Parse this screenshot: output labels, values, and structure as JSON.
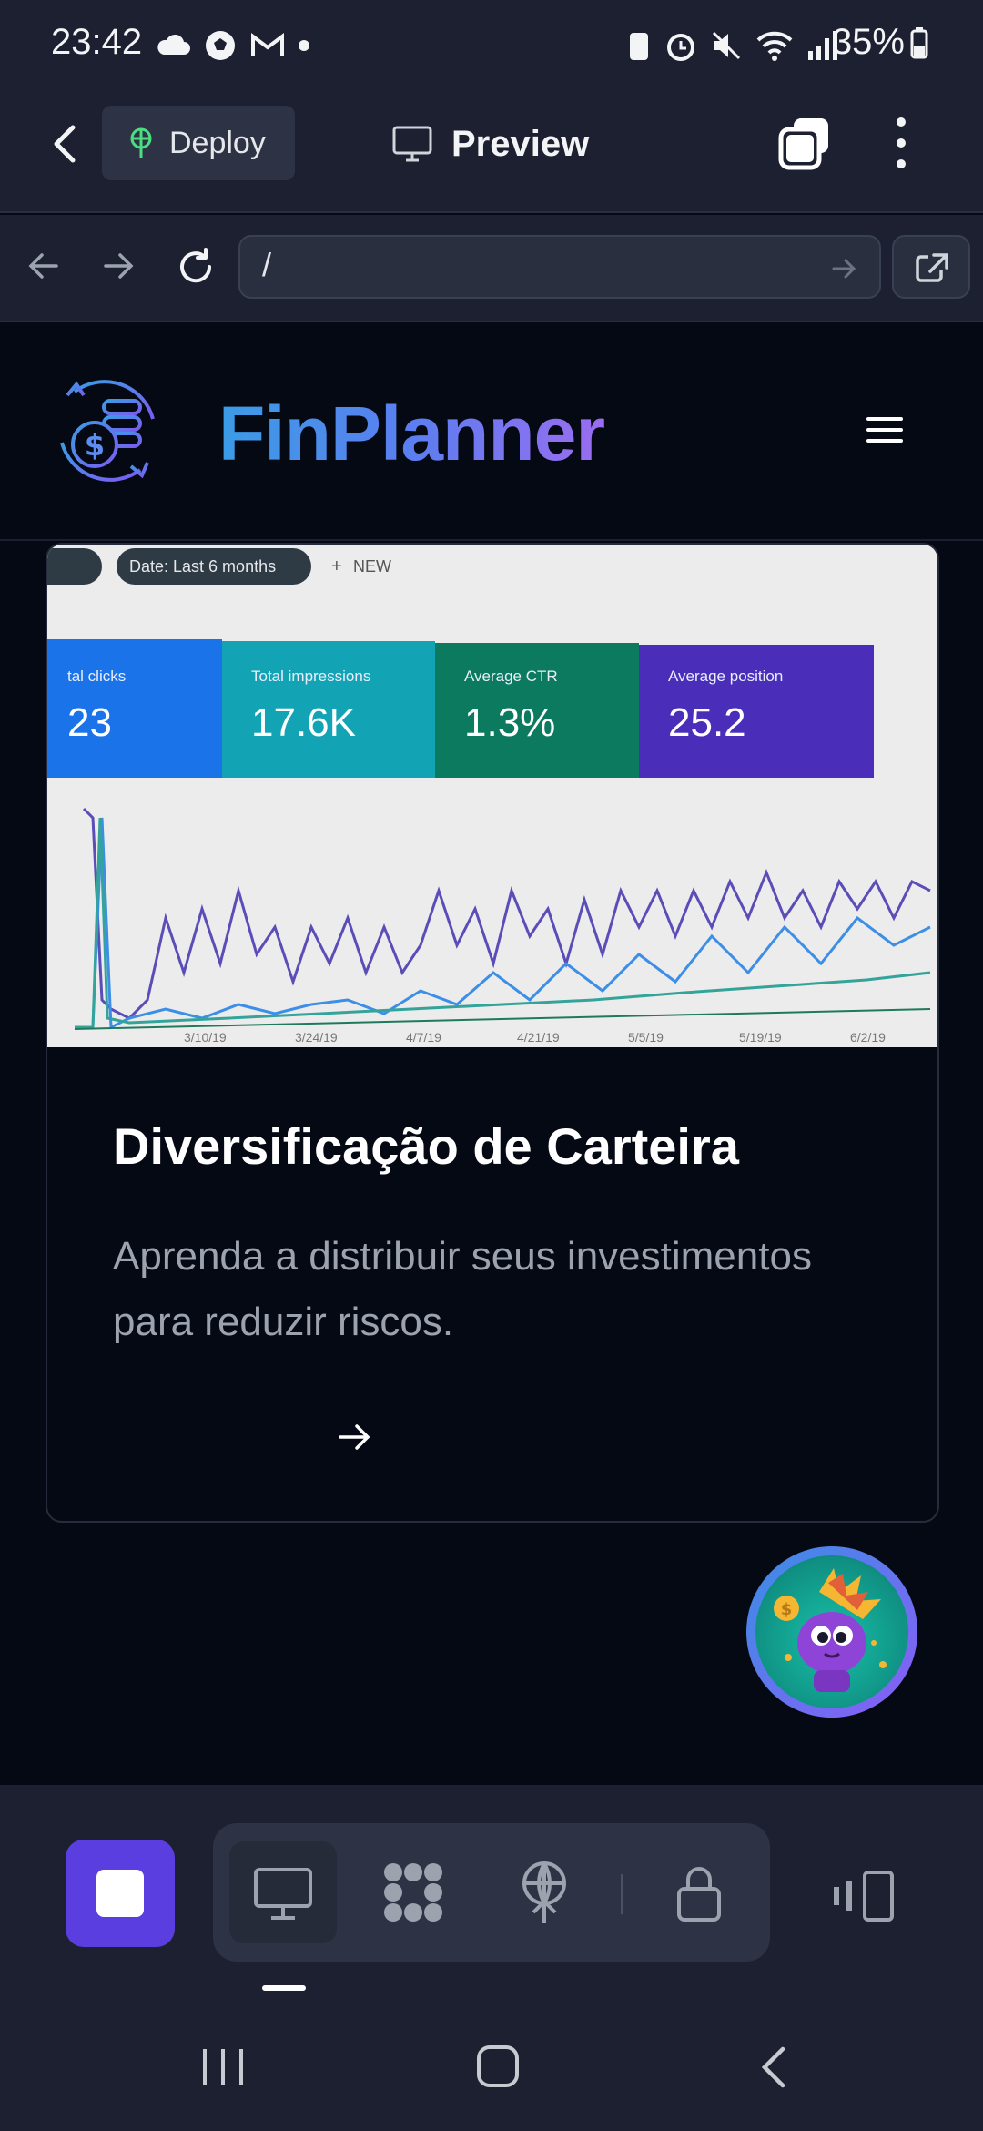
{
  "status_bar": {
    "time": "23:42",
    "battery": "35%"
  },
  "app_bar": {
    "back_icon": "chevron-left-icon",
    "deploy_label": "Deploy",
    "preview_label": "Preview"
  },
  "browser": {
    "url": "/"
  },
  "site": {
    "brand": "FinPlanner"
  },
  "card": {
    "image_alt": "Search console performance chart",
    "image_chips": [
      "Date: Last 6 months",
      "NEW"
    ],
    "metrics": [
      {
        "label": "tal clicks",
        "value": "23",
        "color": "#1a73e8"
      },
      {
        "label": "Total impressions",
        "value": "17.6K",
        "color": "#12a4b4"
      },
      {
        "label": "Average CTR",
        "value": "1.3%",
        "color": "#0b7a5e"
      },
      {
        "label": "Average position",
        "value": "25.2",
        "color": "#4a2db8"
      }
    ],
    "x_ticks": [
      "3/10/19",
      "3/24/19",
      "4/7/19",
      "4/21/19",
      "5/5/19",
      "5/19/19",
      "6/2/19"
    ],
    "title": "Diversificação de Carteira",
    "description": "Aprenda a distribuir seus investimentos para reduzir riscos."
  },
  "colors": {
    "accent": "#5b3ee0",
    "brand_gradient_start": "#3b9ce6",
    "brand_gradient_end": "#9b6cf0"
  }
}
